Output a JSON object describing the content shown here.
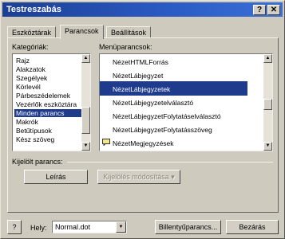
{
  "window": {
    "title": "Testreszabás",
    "help_btn": "?",
    "close_btn": "✕"
  },
  "tabs": [
    {
      "label": "Eszköztárak",
      "active": false
    },
    {
      "label": "Parancsok",
      "active": true
    },
    {
      "label": "Beállítások",
      "active": false
    }
  ],
  "categories": {
    "label": "Kategóriák:",
    "items": [
      "Rajz",
      "Alakzatok",
      "Szegélyek",
      "Körlevél",
      "Párbeszédelemek",
      "Vezérlők eszköztára",
      "Minden parancs",
      "Makrók",
      "Betűtípusok",
      "Kész szöveg"
    ],
    "selected_index": 6
  },
  "commands": {
    "label": "Menüparancsok:",
    "items": [
      {
        "text": "NézetHTMLForrás",
        "icon": ""
      },
      {
        "text": "NézetLábjegyzet",
        "icon": ""
      },
      {
        "text": "NézetLábjegyzetek",
        "icon": ""
      },
      {
        "text": "NézetLábjegyzetelválasztó",
        "icon": ""
      },
      {
        "text": "NézetLábjegyzetFolytatáselválasztó",
        "icon": ""
      },
      {
        "text": "NézetLábjegyzetFolytatásszöveg",
        "icon": ""
      },
      {
        "text": "NézetMegjegyzések",
        "icon": "comment-icon"
      }
    ],
    "selected_index": 2
  },
  "selected_command": {
    "label": "Kijelölt parancs:",
    "description_btn": "Leírás",
    "modify_btn": "Kijelölés módosítása",
    "modify_arrow": "▾"
  },
  "footer": {
    "help_icon": "?",
    "save_in_label": "Hely:",
    "save_in_value": "Normal.dot",
    "keyboard_btn": "Billentyűparancs...",
    "close_btn": "Bezárás"
  }
}
